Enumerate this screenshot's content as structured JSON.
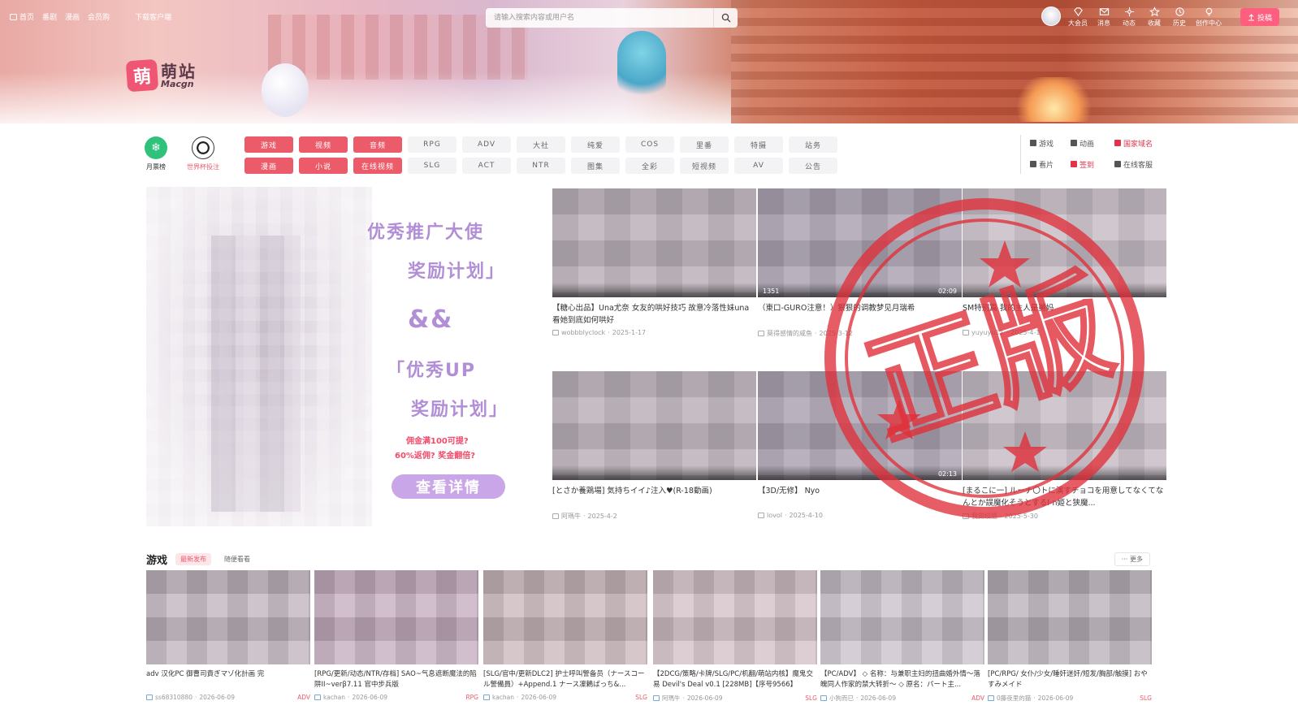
{
  "topnav": {
    "items": [
      "首页",
      "番剧",
      "漫画",
      "会员购",
      "下载客户端"
    ]
  },
  "search": {
    "placeholder": "请输入搜索内容或用户名"
  },
  "usernav": {
    "items": [
      {
        "label": "大会员",
        "icon": "diamond-icon"
      },
      {
        "label": "消息",
        "icon": "mail-icon"
      },
      {
        "label": "动态",
        "icon": "wind-icon"
      },
      {
        "label": "收藏",
        "icon": "star-icon"
      },
      {
        "label": "历史",
        "icon": "clock-icon"
      },
      {
        "label": "创作中心",
        "icon": "bulb-icon"
      }
    ],
    "post_label": "投稿"
  },
  "logo": {
    "cn": "萌站",
    "mark": "萌",
    "en": "Macgn"
  },
  "ranks": [
    {
      "label": "月票榜",
      "icon": "snowflake-icon"
    },
    {
      "label": "世界杯投注",
      "icon": "soccer-ball-icon"
    }
  ],
  "categories": {
    "row1": [
      "游戏",
      "视频",
      "音频",
      "RPG",
      "ADV",
      "大社",
      "纯爱",
      "COS",
      "里番",
      "特摄",
      "站务"
    ],
    "row2": [
      "漫画",
      "小说",
      "在线视频",
      "SLG",
      "ACT",
      "NTR",
      "图集",
      "全彩",
      "短视频",
      "AV",
      "公告"
    ],
    "hot_count": 3
  },
  "quick": {
    "items": [
      {
        "label": "游戏",
        "red": false
      },
      {
        "label": "动画",
        "red": false
      },
      {
        "label": "国家域名",
        "red": true
      },
      {
        "label": "看片",
        "red": false
      },
      {
        "label": "签到",
        "red": true
      },
      {
        "label": "在线客服",
        "red": false
      }
    ]
  },
  "promo": {
    "line1": "优秀推广大使",
    "line2": "奖励计划」",
    "line3": "&&",
    "line4": "「优秀UP",
    "line5": "奖励计划」",
    "small1": "佣金满100可提?",
    "small2": "60%返佣? 奖金翻倍?",
    "button": "查看详情"
  },
  "featured": [
    {
      "title": "【糖心出品】Una尤奈 女友的哄好技巧 故意冷落性妹una 看她到底如何哄好",
      "author": "wobbblyclock",
      "date": "2025-1-17",
      "views": "",
      "duration": ""
    },
    {
      "title": "（東口-GURO注意！）狠狠的调教梦见月瑞希",
      "author": "莫得感情的咸鱼",
      "date": "2025-3-12",
      "views": "1351",
      "duration": "02:09"
    },
    {
      "title": "SM特别篇 我的主人是舅妈",
      "author": "yuyuyu11",
      "date": "2025-4-1",
      "views": "",
      "duration": ""
    },
    {
      "title": "[とさか養鶏場] 気持ちイイ♪注入♥(R-18動画)",
      "author": "阿瑪牛",
      "date": "2025-4-2",
      "views": "",
      "duration": ""
    },
    {
      "title": "【3D/无修】 Nyo",
      "author": "lovol",
      "date": "2025-4-10",
      "views": "",
      "duration": "02:13"
    },
    {
      "title": "[まるこに一] ルーナ〇トに演すチョコを用意してなくてなんとか誤魔化そうとするI-n姫と狭魔...",
      "author": "我觉校猫",
      "date": "2025-5-30",
      "views": "",
      "duration": ""
    }
  ],
  "games_section": {
    "title": "游戏",
    "tabs": [
      "最新发布",
      "随便看看"
    ],
    "more": "更多",
    "items": [
      {
        "title": "adv 汉化PC 御曹司責ぎマゾ化計画 完",
        "author": "ss68310880",
        "date": "2026-06-09",
        "tag": "ADV"
      },
      {
        "title": "[RPG/更新/动态/NTR/存档] SAO~气息遮断魔法的陷阱II~verβ7.11 官中步兵版",
        "author": "kachan",
        "date": "2026-06-09",
        "tag": "RPG"
      },
      {
        "title": "[SLG/官中/更新DLC2] 护士呼叫警备员（ナースコール警備員）+Append.1 ナース凜鶫ぱっち&...",
        "author": "kachan",
        "date": "2026-06-09",
        "tag": "SLG"
      },
      {
        "title": "【2DCG/策略/卡牌/SLG/PC/机翻/萌站内核】魔鬼交易 Devil's Deal v0.1 [228MB]【序号9566】",
        "author": "阿瑪牛",
        "date": "2026-06-09",
        "tag": "SLG"
      },
      {
        "title": "【PC/ADV】 ◇ 名称：与兼职主妇的扭曲婚外情～落魄同人作家的禁大转折～ ◇ 原名：パート主...",
        "author": "小狗而已",
        "date": "2026-06-09",
        "tag": "ADV"
      },
      {
        "title": "[PC/RPG/ 女仆/少女/睡奸迷奸/短发/胸部/触摸] おやすみメイド",
        "author": "0藤夜里的猫",
        "date": "2026-06-09",
        "tag": "SLG"
      }
    ]
  },
  "stamp": {
    "text": "正版",
    "color": "#e0303a"
  }
}
